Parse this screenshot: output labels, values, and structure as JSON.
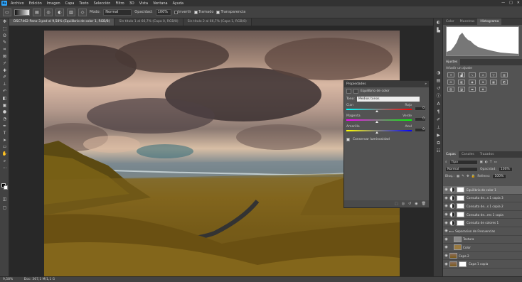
{
  "app": {
    "logo": "Ps"
  },
  "menu": [
    "Archivo",
    "Edición",
    "Imagen",
    "Capa",
    "Texto",
    "Selección",
    "Filtro",
    "3D",
    "Vista",
    "Ventana",
    "Ayuda"
  ],
  "window_controls": [
    "—",
    "□",
    "✕"
  ],
  "options_bar": {
    "mode_label": "Modo:",
    "mode_value": "Normal",
    "opacity_label": "Opacidad:",
    "opacity_value": "100%",
    "invert_label": "Invertir",
    "dither_label": "Tramado",
    "transparency_label": "Transparencia"
  },
  "doc_tabs": [
    {
      "label": "DSC7462-Pano-3.psd al 9,58% (Equilibrio de color 1, RGB/8)",
      "active": true
    },
    {
      "label": "Sin título 1 al 66,7% (Capa 0, RGB/8)",
      "active": false
    },
    {
      "label": "Sin título 2 al 66,7% (Capa 1, RGB/8)",
      "active": false
    }
  ],
  "properties": {
    "title": "Propiedades",
    "close_label": "»",
    "adjustment_name": "Equilibrio de color",
    "tone_label": "Tono:",
    "tone_value": "Medios tonos",
    "sliders": [
      {
        "left": "Cian",
        "right": "Rojo",
        "value": 0
      },
      {
        "left": "Magenta",
        "right": "Verde",
        "value": 0
      },
      {
        "left": "Amarillo",
        "right": "Azul",
        "value": 0
      }
    ],
    "preserve_label": "Conservar luminosidad",
    "footer_icons": [
      "⬚",
      "◎",
      "↺",
      "◉",
      "🗑"
    ]
  },
  "top_panel": {
    "tabs": [
      {
        "label": "Color",
        "active": false
      },
      {
        "label": "Muestras",
        "active": false
      },
      {
        "label": "Histograma",
        "active": true
      }
    ]
  },
  "adjust_panel": {
    "tabs": [
      {
        "label": "Ajustes",
        "active": true
      }
    ],
    "hint": "Añadir un ajuste"
  },
  "layers_panel": {
    "tabs": [
      {
        "label": "Capas",
        "active": true
      },
      {
        "label": "Canales",
        "active": false
      },
      {
        "label": "Trazados",
        "active": false
      }
    ],
    "filter_label": "Tipo",
    "blend_mode": "Normal",
    "opacity_label": "Opacidad:",
    "opacity_value": "100%",
    "lock_label": "Bloq.:",
    "fill_label": "Relleno:",
    "fill_value": "100%",
    "layers": [
      {
        "name": "Equilibrio de color 1",
        "type": "adjustment",
        "selected": true
      },
      {
        "name": "Consulta de...s 1 copia 3",
        "type": "adjustment",
        "selected": false
      },
      {
        "name": "Consulta de...s 1 copia 2",
        "type": "adjustment",
        "selected": false
      },
      {
        "name": "Consulta de...res 1 copia",
        "type": "adjustment",
        "selected": false
      },
      {
        "name": "Consulta de colores 1",
        "type": "adjustment",
        "selected": false
      },
      {
        "name": "Separacion de Frecuencias",
        "type": "group",
        "selected": false
      },
      {
        "name": "Textura",
        "type": "pixel",
        "selected": false
      },
      {
        "name": "Color",
        "type": "pixel",
        "selected": false
      },
      {
        "name": "Capa 2",
        "type": "pixel",
        "selected": false
      },
      {
        "name": "Capa 1 copia",
        "type": "pixel",
        "selected": false
      }
    ]
  },
  "status": {
    "zoom": "9,58%",
    "doc": "Doc: 367,1 M/1,1 G"
  }
}
